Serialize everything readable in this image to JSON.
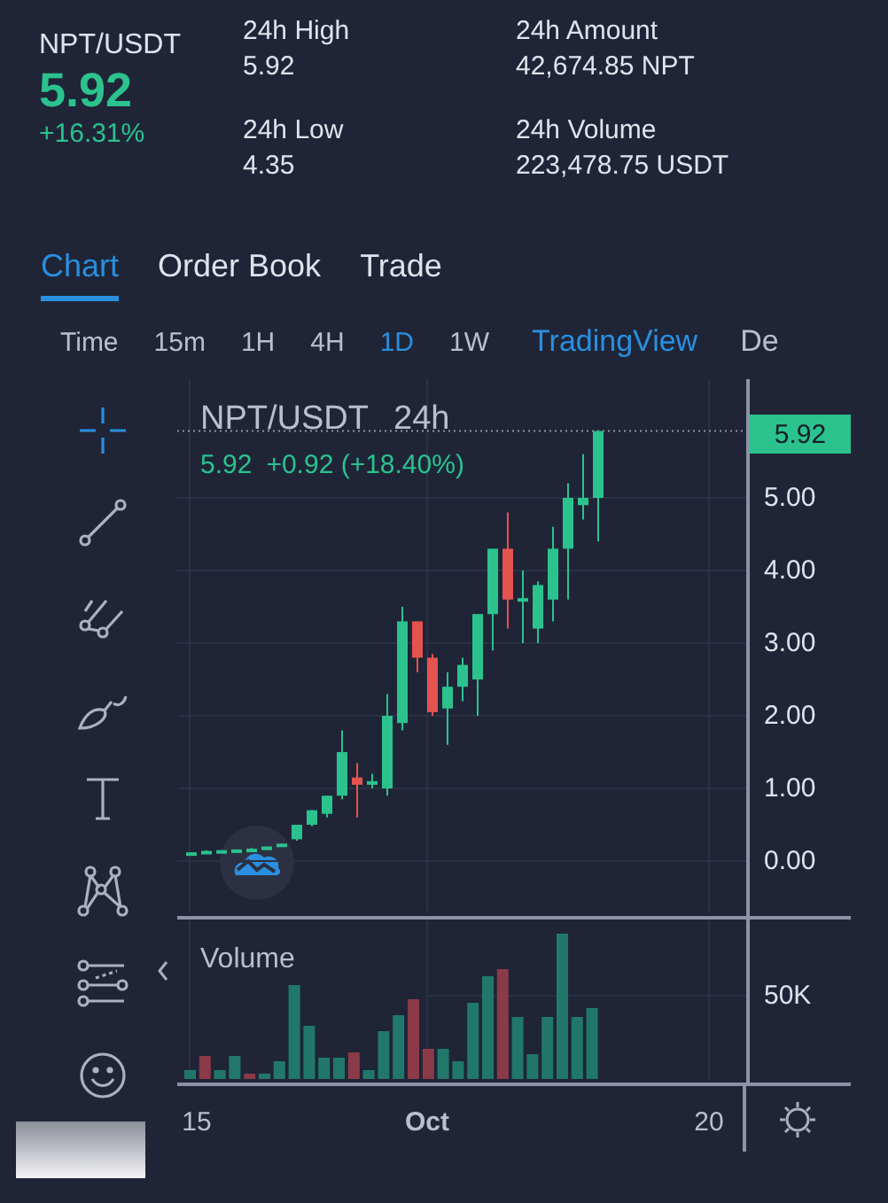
{
  "pair": "NPT/USDT",
  "price": "5.92",
  "change": "+16.31%",
  "stats": [
    {
      "label": "24h High",
      "value": "5.92"
    },
    {
      "label": "24h Amount",
      "value": "42,674.85 NPT"
    },
    {
      "label": "24h Low",
      "value": "4.35"
    },
    {
      "label": "24h Volume",
      "value": "223,478.75 USDT"
    }
  ],
  "tabs": [
    {
      "label": "Chart",
      "selected": true
    },
    {
      "label": "Order Book",
      "selected": false
    },
    {
      "label": "Trade",
      "selected": false
    }
  ],
  "intervals": [
    {
      "label": "Time",
      "selected": false
    },
    {
      "label": "15m",
      "selected": false
    },
    {
      "label": "1H",
      "selected": false
    },
    {
      "label": "4H",
      "selected": false
    },
    {
      "label": "1D",
      "selected": true
    },
    {
      "label": "1W",
      "selected": false
    }
  ],
  "views": [
    {
      "label": "TradingView",
      "selected": true
    },
    {
      "label": "De",
      "selected": false
    }
  ],
  "chart": {
    "title": "NPT/USDT",
    "period": "24h",
    "legend_price": "5.92",
    "legend_change": "+0.92 (+18.40%)",
    "last_price": "5.92",
    "price_ticks": [
      "5.00",
      "4.00",
      "3.00",
      "2.00",
      "1.00",
      "0.00"
    ],
    "volume_label": "Volume",
    "volume_tick": "50K",
    "x_ticks": [
      "15",
      "Oct",
      "20"
    ]
  }
}
